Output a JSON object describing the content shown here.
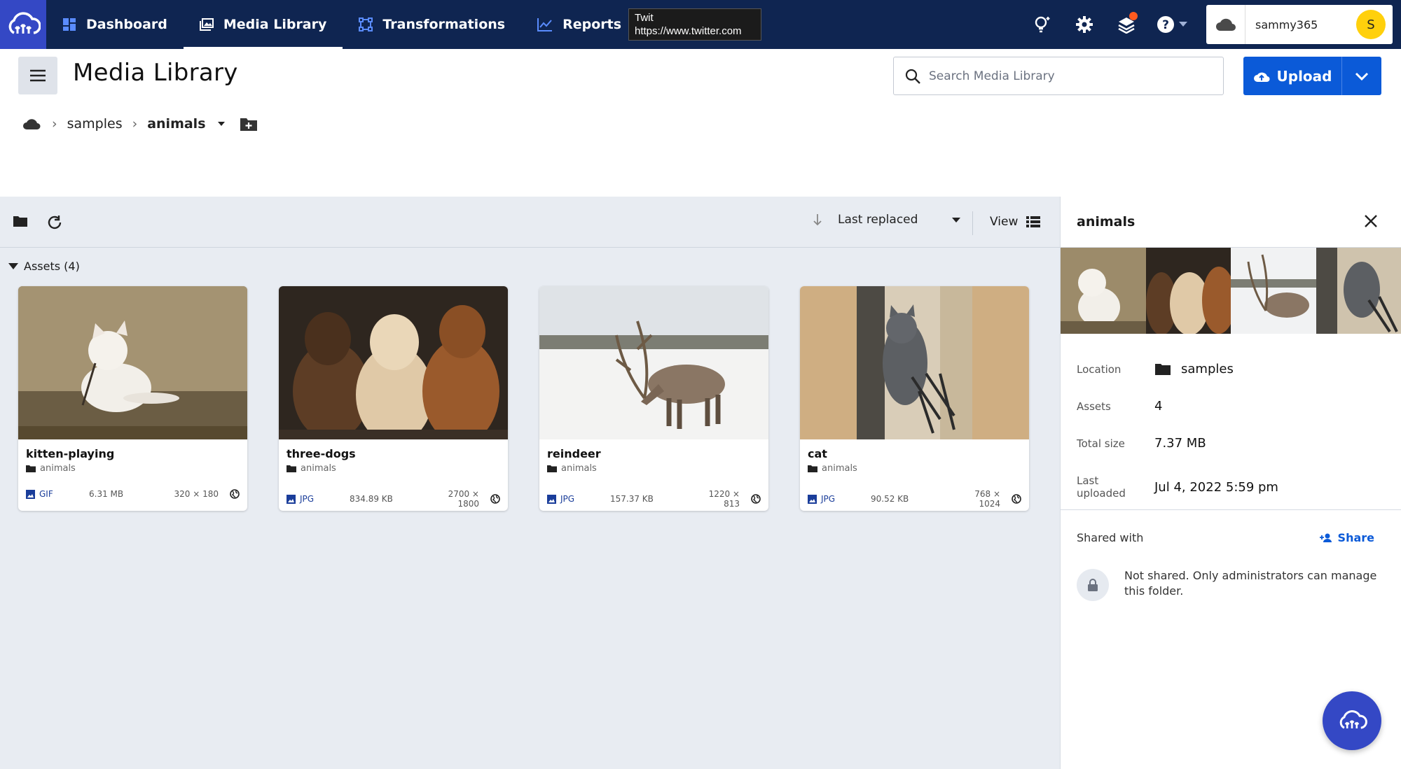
{
  "nav": {
    "items": [
      {
        "label": "Dashboard",
        "icon": "dashboard-icon"
      },
      {
        "label": "Media Library",
        "icon": "media-library-icon",
        "active": true
      },
      {
        "label": "Transformations",
        "icon": "transformations-icon"
      },
      {
        "label": "Reports",
        "icon": "reports-icon"
      }
    ],
    "tooltip_line1": "Twit",
    "tooltip_line2": "https://www.twitter.com",
    "account_name": "sammy365",
    "avatar_initial": "S"
  },
  "header": {
    "title": "Media Library",
    "search_placeholder": "Search Media Library",
    "upload_label": "Upload"
  },
  "breadcrumb": {
    "items": [
      "samples",
      "animals"
    ]
  },
  "toolbar": {
    "sort_label": "Last replaced",
    "view_label": "View"
  },
  "assets": {
    "section_title": "Assets (4)",
    "items": [
      {
        "name": "kitten-playing",
        "folder": "animals",
        "format": "GIF",
        "size": "6.31 MB",
        "dims": "320 × 180"
      },
      {
        "name": "three-dogs",
        "folder": "animals",
        "format": "JPG",
        "size": "834.89 KB",
        "dims": "2700 × 1800"
      },
      {
        "name": "reindeer",
        "folder": "animals",
        "format": "JPG",
        "size": "157.37 KB",
        "dims": "1220 × 813"
      },
      {
        "name": "cat",
        "folder": "animals",
        "format": "JPG",
        "size": "90.52 KB",
        "dims": "768 × 1024"
      }
    ]
  },
  "panel": {
    "title": "animals",
    "location_label": "Location",
    "location_value": "samples",
    "assets_label": "Assets",
    "assets_value": "4",
    "size_label": "Total size",
    "size_value": "7.37 MB",
    "uploaded_label_1": "Last",
    "uploaded_label_2": "uploaded",
    "uploaded_value": "Jul 4, 2022 5:59 pm",
    "shared_label": "Shared with",
    "share_button": "Share",
    "not_shared": "Not shared. Only administrators can manage this folder."
  },
  "colors": {
    "nav_bg": "#0f2551",
    "brand_blue": "#3448c5",
    "primary_button": "#0b5ad8",
    "content_bg": "#e8ecf2"
  }
}
